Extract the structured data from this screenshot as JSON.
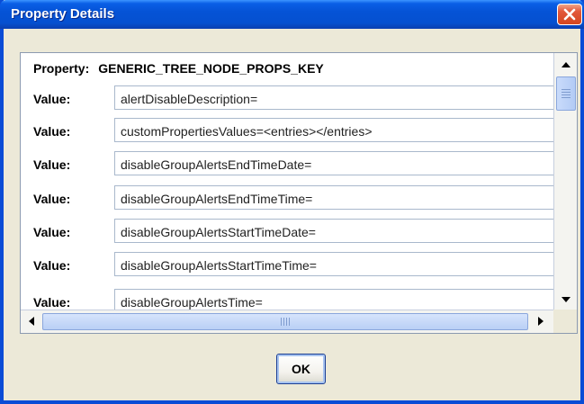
{
  "window": {
    "title": "Property Details"
  },
  "property": {
    "label": "Property:",
    "name": "GENERIC_TREE_NODE_PROPS_KEY"
  },
  "values": [
    {
      "label": "Value:",
      "value": "alertDisableDescription="
    },
    {
      "label": "Value:",
      "value": "customPropertiesValues=<entries></entries>"
    },
    {
      "label": "Value:",
      "value": "disableGroupAlertsEndTimeDate="
    },
    {
      "label": "Value:",
      "value": "disableGroupAlertsEndTimeTime="
    },
    {
      "label": "Value:",
      "value": "disableGroupAlertsStartTimeDate="
    },
    {
      "label": "Value:",
      "value": "disableGroupAlertsStartTimeTime="
    },
    {
      "label": "Value:",
      "value": "disableGroupAlertsTime="
    }
  ],
  "buttons": {
    "ok_label": "OK"
  },
  "icons": {
    "close": "close-icon",
    "scroll_up": "arrow-up-icon",
    "scroll_down": "arrow-down-icon",
    "scroll_left": "arrow-left-icon",
    "scroll_right": "arrow-right-icon"
  },
  "colors": {
    "titlebar": "#0553d6",
    "close_button": "#d4461f",
    "window_bg": "#ece9d8",
    "field_border": "#a9b8cc"
  }
}
